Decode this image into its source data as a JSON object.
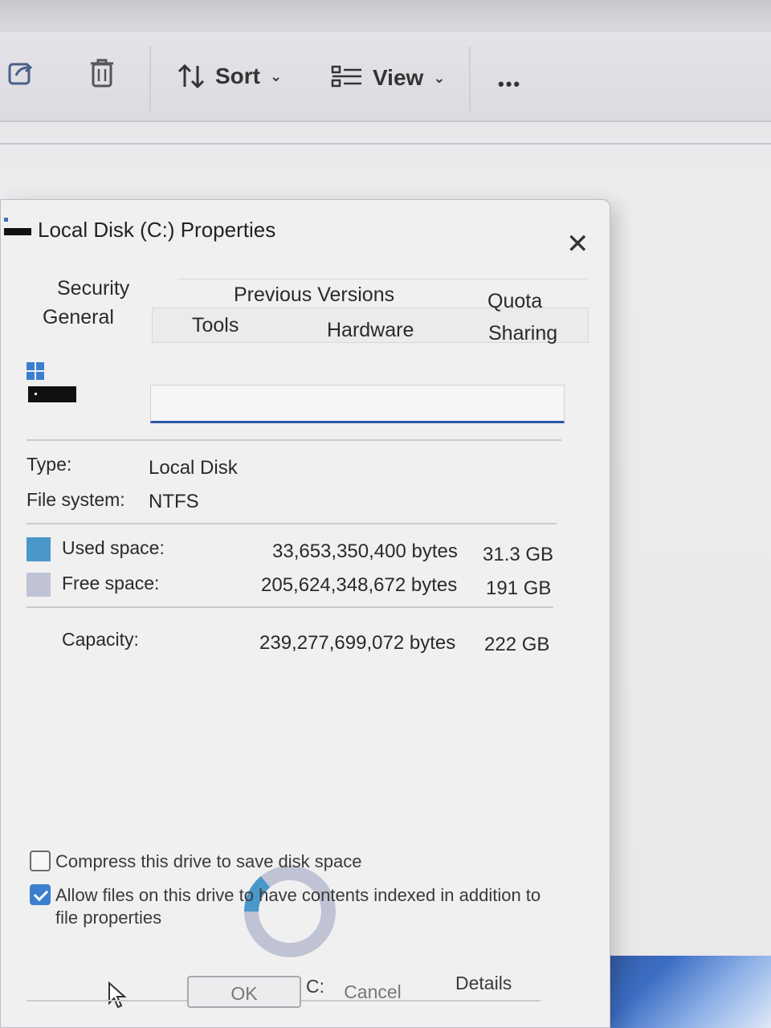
{
  "toolbar": {
    "sort_label": "Sort",
    "view_label": "View",
    "more_label": "•••"
  },
  "dialog": {
    "title": "Local Disk (C:) Properties",
    "close_label": "✕",
    "tabs_row1": [
      "Security",
      "Previous Versions",
      "Quota"
    ],
    "tabs_row2": [
      "General",
      "Tools",
      "Hardware",
      "Sharing"
    ],
    "active_tab": "General",
    "name_value": "",
    "type_label": "Type:",
    "type_value": "Local Disk",
    "fs_label": "File system:",
    "fs_value": "NTFS",
    "used_label": "Used space:",
    "used_bytes": "33,653,350,400 bytes",
    "used_gb": "31.3 GB",
    "free_label": "Free space:",
    "free_bytes": "205,624,348,672 bytes",
    "free_gb": "191 GB",
    "capacity_label": "Capacity:",
    "capacity_bytes": "239,277,699,072 bytes",
    "capacity_gb": "222 GB",
    "used_fraction": 0.14,
    "drive_label": "Drive C:",
    "details_label": "Details",
    "compress_label": "Compress this drive to save disk space",
    "compress_checked": false,
    "index_label_line1": "Allow files on this drive to have contents indexed in addition to",
    "index_label_line2": "file properties",
    "index_checked": true,
    "ok_label": "OK",
    "cancel_label": "Cancel"
  },
  "colors": {
    "used": "#4a97c9",
    "free": "#bfc3d3",
    "accent": "#2e5aa8"
  }
}
